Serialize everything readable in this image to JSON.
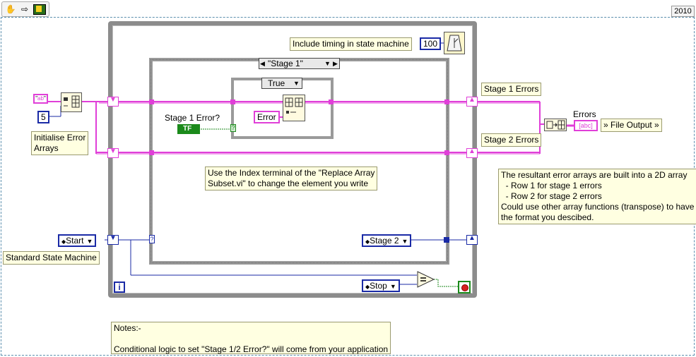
{
  "toolbar": {
    "hand_icon": "hand-icon",
    "arrow_icon": "arrow-icon",
    "probe_icon": "probe-icon"
  },
  "version_label": "2010",
  "timing_note": "Include timing in state machine",
  "timing_constant": "100",
  "case_selector": "\"Stage 1\"",
  "inner_case_selector": "True",
  "stage1_error_label": "Stage 1 Error?",
  "tf_terminal": "TF",
  "error_constant": "Error",
  "init_const": "5",
  "init_note": "Initialise Error\nArrays",
  "replace_note": "Use the Index terminal of the \"Replace Array\nSubset.vi\" to change the element you write",
  "start_enum": "Start",
  "stage2_enum": "Stage 2",
  "stop_enum": "Stop",
  "state_machine_note": "Standard State Machine",
  "iteration_terminal": "i",
  "stage1_errors_label": "Stage 1 Errors",
  "stage2_errors_label": "Stage 2 Errors",
  "errors_label": "Errors",
  "errors_indicator": "[abc]",
  "file_output_label": "» File Output »",
  "result_note": "The resultant error arrays are built into a 2D array\n  - Row 1 for stage 1 errors\n  - Row 2 for stage 2 errors\nCould use other array functions (transpose) to have\nthe format you descibed.",
  "bottom_note": "Notes:-\n\nConditional logic to set \"Stage 1/2 Error?\" will come from your application",
  "colors": {
    "pink_wire": "#e03fd8",
    "blue_wire": "#1a2aa6",
    "green_wire": "#1b8a1b",
    "loop_frame": "#8a8a8a",
    "note_bg": "#ffffe1"
  }
}
